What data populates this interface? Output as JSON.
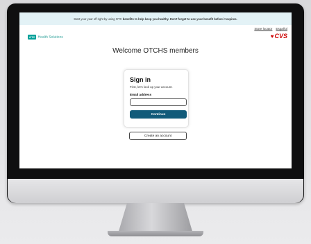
{
  "banner": {
    "text_before": "Start your year off right by using OTC",
    "text_bold": "benefits to help keep you healthy. Don't forget to use your benefit before it expires."
  },
  "utility_links": [
    "Store locator",
    "Español"
  ],
  "brand": {
    "otc_box": "OTC",
    "otc_text": "Health Solutions",
    "cvs_text": "CVS",
    "cvs_color": "#cc0000"
  },
  "page": {
    "welcome": "Welcome OTCHS members"
  },
  "signin": {
    "title": "Sign in",
    "subtitle": "First, let's look up your account.",
    "email_label": "Email address",
    "email_value": "",
    "continue_label": "Continue",
    "create_account_label": "Create an account"
  },
  "colors": {
    "primary_button": "#115b7a",
    "banner_bg": "#e3f2f6"
  }
}
